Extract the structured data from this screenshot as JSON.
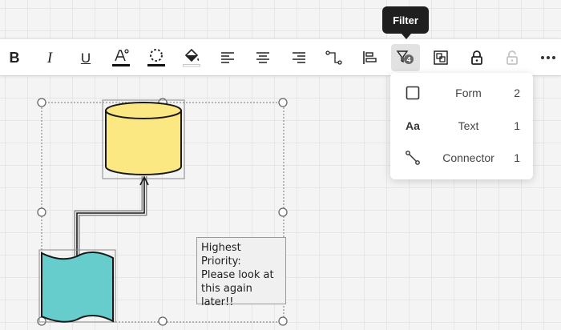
{
  "toolbar": {
    "bold_label": "B",
    "italic_label": "I",
    "underline_label": "U",
    "filter_badge": "4",
    "buttons": [
      "bold",
      "italic",
      "underline",
      "font-color",
      "border-style",
      "fill-color",
      "align-left",
      "align-center",
      "align-right",
      "connector-style",
      "align-objects",
      "filter",
      "group",
      "lock",
      "unlock",
      "more"
    ]
  },
  "tooltip": {
    "text": "Filter"
  },
  "filter_menu": {
    "items": [
      {
        "label": "Form",
        "count": "2",
        "icon": "square-icon"
      },
      {
        "label": "Text",
        "count": "1",
        "icon": "text-aa-icon",
        "icon_text": "Aa"
      },
      {
        "label": "Connector",
        "count": "1",
        "icon": "connector-icon"
      }
    ]
  },
  "canvas": {
    "note_lines": [
      "Highest",
      "Priority:",
      "Please look at",
      "this again",
      "later!!"
    ]
  },
  "colors": {
    "cylinder_fill": "#fce882",
    "banner_fill": "#66cccc",
    "toolbar_bg": "#ffffff",
    "tooltip_bg": "#1f1f1f",
    "active_button_bg": "#e2e2e2"
  }
}
